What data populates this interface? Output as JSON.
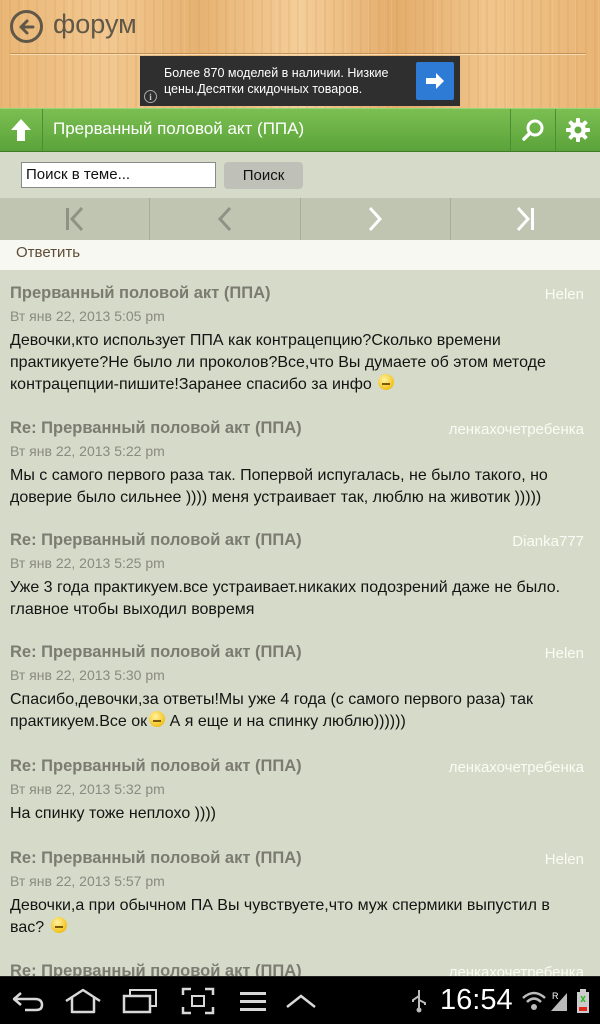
{
  "header": {
    "app_title": "форум",
    "ad_text": "Более 870 моделей в наличии. Низкие цены.Десятки скидочных товаров."
  },
  "topic_bar": {
    "title": "Прерванный половой акт (ППА)"
  },
  "search": {
    "input_value": "Поиск в теме...",
    "button_label": "Поиск"
  },
  "reply": {
    "label": "Ответить"
  },
  "posts": [
    {
      "title": "Прерванный половой акт (ППА)",
      "author": "Helen",
      "date": "Вт янв 22, 2013 5:05 pm",
      "body_1": "Девочки,кто использует ППА как контрацепцию?Сколько времени практикуете?Не было ли проколов?Все,что Вы думаете об этом методе контрацепции-пишите!Заранее спасибо за инфо",
      "body_2": ""
    },
    {
      "title": "Re: Прерванный половой акт (ППА)",
      "author": "ленкахочетребенка",
      "date": "Вт янв 22, 2013 5:22 pm",
      "body_1": "Мы с самого первого раза так. Попервой испугалась, не было такого, но доверие было сильнее )))) меня устраивает так, люблю на животик )))))",
      "body_2": ""
    },
    {
      "title": "Re: Прерванный половой акт (ППА)",
      "author": "Dianka777",
      "date": "Вт янв 22, 2013 5:25 pm",
      "body_1": "Уже 3 года практикуем.все устраивает.никаких подозрений даже не было. главное чтобы выходил вовремя",
      "body_2": ""
    },
    {
      "title": "Re: Прерванный половой акт (ППА)",
      "author": "Helen",
      "date": "Вт янв 22, 2013 5:30 pm",
      "body_1": "Спасибо,девочки,за ответы!Мы уже 4 года (с самого первого раза) так практикуем.Все ок",
      "body_2": " А я еще и на спинку люблю))))))"
    },
    {
      "title": "Re: Прерванный половой акт (ППА)",
      "author": "ленкахочетребенка",
      "date": "Вт янв 22, 2013 5:32 pm",
      "body_1": "На спинку тоже неплохо ))))",
      "body_2": ""
    },
    {
      "title": "Re: Прерванный половой акт (ППА)",
      "author": "Helen",
      "date": "Вт янв 22, 2013 5:57 pm",
      "body_1": "Девочки,а при обычном ПА Вы чувствуете,что муж спермики выпустил в вас?",
      "body_2": ""
    },
    {
      "title": "Re: Прерванный половой акт (ППА)",
      "author": "ленкахочетребенка",
      "date": "",
      "body_1": "",
      "body_2": ""
    }
  ],
  "statusbar": {
    "time": "16:54"
  },
  "colors": {
    "topic_green": "#6fb547",
    "background": "#d6dac8",
    "ad_button": "#2e7bd6"
  },
  "icons": [
    "back-arrow-icon",
    "info-icon",
    "arrow-right-icon",
    "up-arrow-icon",
    "search-icon",
    "gear-icon",
    "first-page-icon",
    "prev-page-icon",
    "next-page-icon",
    "last-page-icon",
    "smiley-icon",
    "nav-back-icon",
    "home-icon",
    "recent-apps-icon",
    "screenshot-icon",
    "menu-icon",
    "chevron-up-icon",
    "usb-icon",
    "wifi-icon",
    "signal-icon",
    "battery-icon"
  ]
}
